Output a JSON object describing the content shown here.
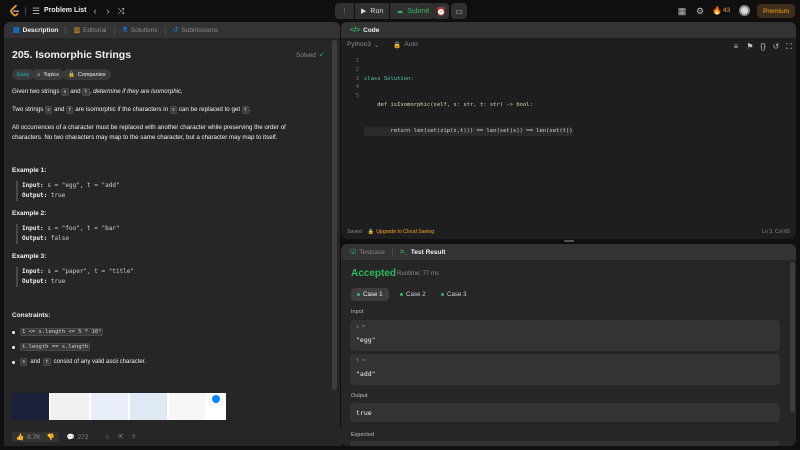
{
  "topbar": {
    "nav_label": "Problem List",
    "run_label": "Run",
    "submit_label": "Submit",
    "streak_count": "43",
    "premium_label": "Premium"
  },
  "left_panel": {
    "tabs": [
      {
        "label": "Description"
      },
      {
        "label": "Editorial"
      },
      {
        "label": "Solutions"
      },
      {
        "label": "Submissions"
      }
    ],
    "title": "205. Isomorphic Strings",
    "status": "Solved",
    "chips": {
      "difficulty": "Easy",
      "topics": "Topics",
      "companies": "Companies"
    },
    "description": {
      "p1_pre": "Given two strings",
      "p1_s": "s",
      "p1_and": "and",
      "p1_t": "t",
      "p1_post": ", determine if they are isomorphic.",
      "p2_pre": "Two strings",
      "p2_s": "s",
      "p2_and": "and",
      "p2_t": "t",
      "p2_mid": "are isomorphic if the characters in",
      "p2_s2": "s",
      "p2_mid2": "can be replaced to get",
      "p2_t2": "t",
      "p2_end": ".",
      "p3_line1": "All occurrences of a character must be replaced with another character while preserving the order of",
      "p3_line2": "characters. No two characters may map to the same character, but a character may map to itself."
    },
    "examples": [
      {
        "title": "Example 1:",
        "input": "s = \"egg\", t = \"add\"",
        "output": "true"
      },
      {
        "title": "Example 2:",
        "input": "s = \"foo\", t = \"bar\"",
        "output": "false"
      },
      {
        "title": "Example 3:",
        "input": "s = \"paper\", t = \"title\"",
        "output": "true"
      }
    ],
    "input_label": "Input:",
    "output_label": "Output:",
    "constraints_title": "Constraints:",
    "constraints": [
      {
        "code": "1 <= s.length <= 5 * 10⁴",
        "text": ""
      },
      {
        "code": "t.length == s.length",
        "text": ""
      },
      {
        "code_s": "s",
        "and": "and",
        "code_t": "t",
        "text": "consist of any valid ascii character."
      }
    ],
    "footer": {
      "likes": "8.7K",
      "comments": "272"
    }
  },
  "editor": {
    "title": "Code",
    "language": "Python3",
    "autocomplete": "Auto",
    "code_lines": [
      {
        "n": "1",
        "text": "class Solution:"
      },
      {
        "n": "2",
        "text": "    def isIsomorphic(self, s: str, t: str) -> bool:"
      },
      {
        "n": "3",
        "text": "        return len(set(zip(s,t))) == len(set(s)) == len(set(t))"
      },
      {
        "n": "4",
        "text": ""
      },
      {
        "n": "5",
        "text": ""
      }
    ],
    "saved": "Saved",
    "upgrade": "Upgrade to Cloud Saving",
    "cursor_pos": "Ln 3, Col 65"
  },
  "result": {
    "tabs": [
      {
        "label": "Testcase"
      },
      {
        "label": "Test Result"
      }
    ],
    "status": "Accepted",
    "runtime": "Runtime: 77 ms",
    "cases": [
      {
        "label": "Case 1"
      },
      {
        "label": "Case 2"
      },
      {
        "label": "Case 3"
      }
    ],
    "input_label": "Input",
    "inputs": [
      {
        "name": "s =",
        "value": "\"egg\""
      },
      {
        "name": "t =",
        "value": "\"add\""
      }
    ],
    "output_label": "Output",
    "output_value": "true",
    "expected_label": "Expected"
  },
  "colors": {
    "accent_green": "#2cbb5d",
    "accent_orange": "#ffa116",
    "accent_blue": "#0a84ff",
    "easy": "#1cbaba"
  }
}
